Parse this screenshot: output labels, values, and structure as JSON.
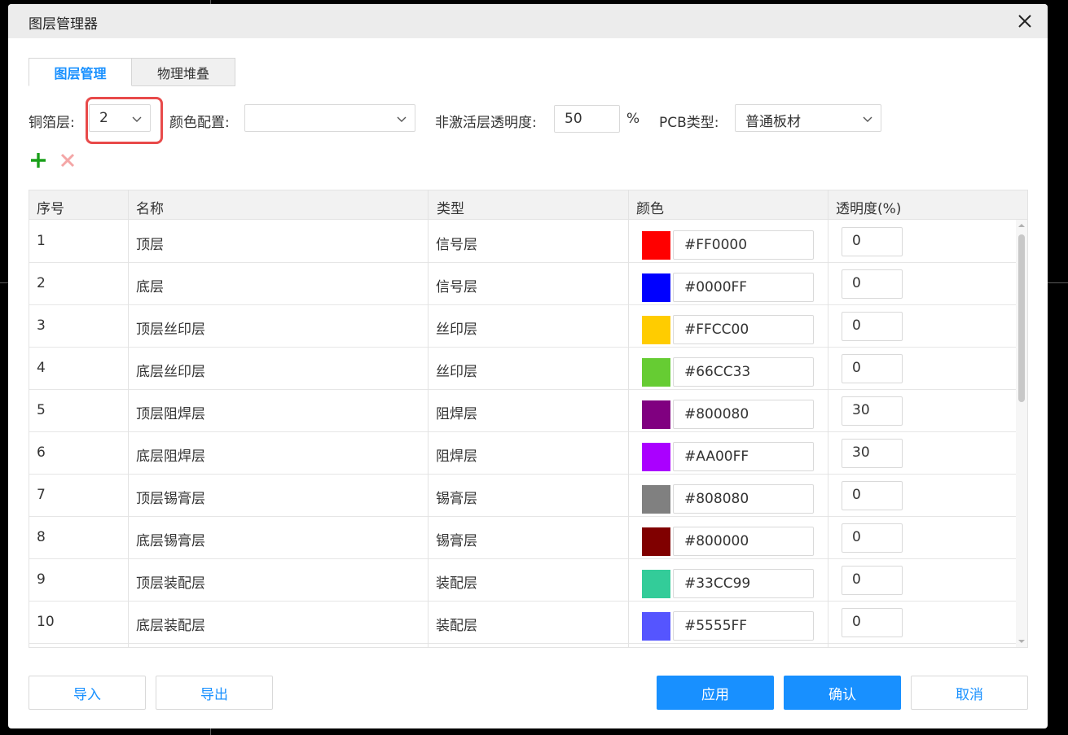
{
  "dialog": {
    "title": "图层管理器"
  },
  "tabs": [
    {
      "label": "图层管理",
      "active": true
    },
    {
      "label": "物理堆叠",
      "active": false
    }
  ],
  "toolbar": {
    "copper_label": "铜箔层:",
    "copper_value": "2",
    "color_config_label": "颜色配置:",
    "color_config_value": "",
    "inactive_opacity_label": "非激活层透明度:",
    "inactive_opacity_value": "50",
    "percent_sign": "%",
    "pcb_type_label": "PCB类型:",
    "pcb_type_value": "普通板材"
  },
  "actions": {
    "add_icon": "plus-icon",
    "delete_icon": "close-icon"
  },
  "table": {
    "headers": {
      "index": "序号",
      "name": "名称",
      "type": "类型",
      "color": "颜色",
      "opacity": "透明度(%)"
    },
    "rows": [
      {
        "index": "1",
        "name": "顶层",
        "type": "信号层",
        "color": "#FF0000",
        "opacity": "0"
      },
      {
        "index": "2",
        "name": "底层",
        "type": "信号层",
        "color": "#0000FF",
        "opacity": "0"
      },
      {
        "index": "3",
        "name": "顶层丝印层",
        "type": "丝印层",
        "color": "#FFCC00",
        "opacity": "0"
      },
      {
        "index": "4",
        "name": "底层丝印层",
        "type": "丝印层",
        "color": "#66CC33",
        "opacity": "0"
      },
      {
        "index": "5",
        "name": "顶层阻焊层",
        "type": "阻焊层",
        "color": "#800080",
        "opacity": "30"
      },
      {
        "index": "6",
        "name": "底层阻焊层",
        "type": "阻焊层",
        "color": "#AA00FF",
        "opacity": "30"
      },
      {
        "index": "7",
        "name": "顶层锡膏层",
        "type": "锡膏层",
        "color": "#808080",
        "opacity": "0"
      },
      {
        "index": "8",
        "name": "底层锡膏层",
        "type": "锡膏层",
        "color": "#800000",
        "opacity": "0"
      },
      {
        "index": "9",
        "name": "顶层装配层",
        "type": "装配层",
        "color": "#33CC99",
        "opacity": "0"
      },
      {
        "index": "10",
        "name": "底层装配层",
        "type": "装配层",
        "color": "#5555FF",
        "opacity": "0"
      }
    ]
  },
  "footer": {
    "import": "导入",
    "export": "导出",
    "apply": "应用",
    "confirm": "确认",
    "cancel": "取消"
  },
  "colors": {
    "accent": "#1890ff",
    "highlight": "#e84a4a",
    "add": "#1aa01a",
    "delete": "#f4a6a6"
  }
}
